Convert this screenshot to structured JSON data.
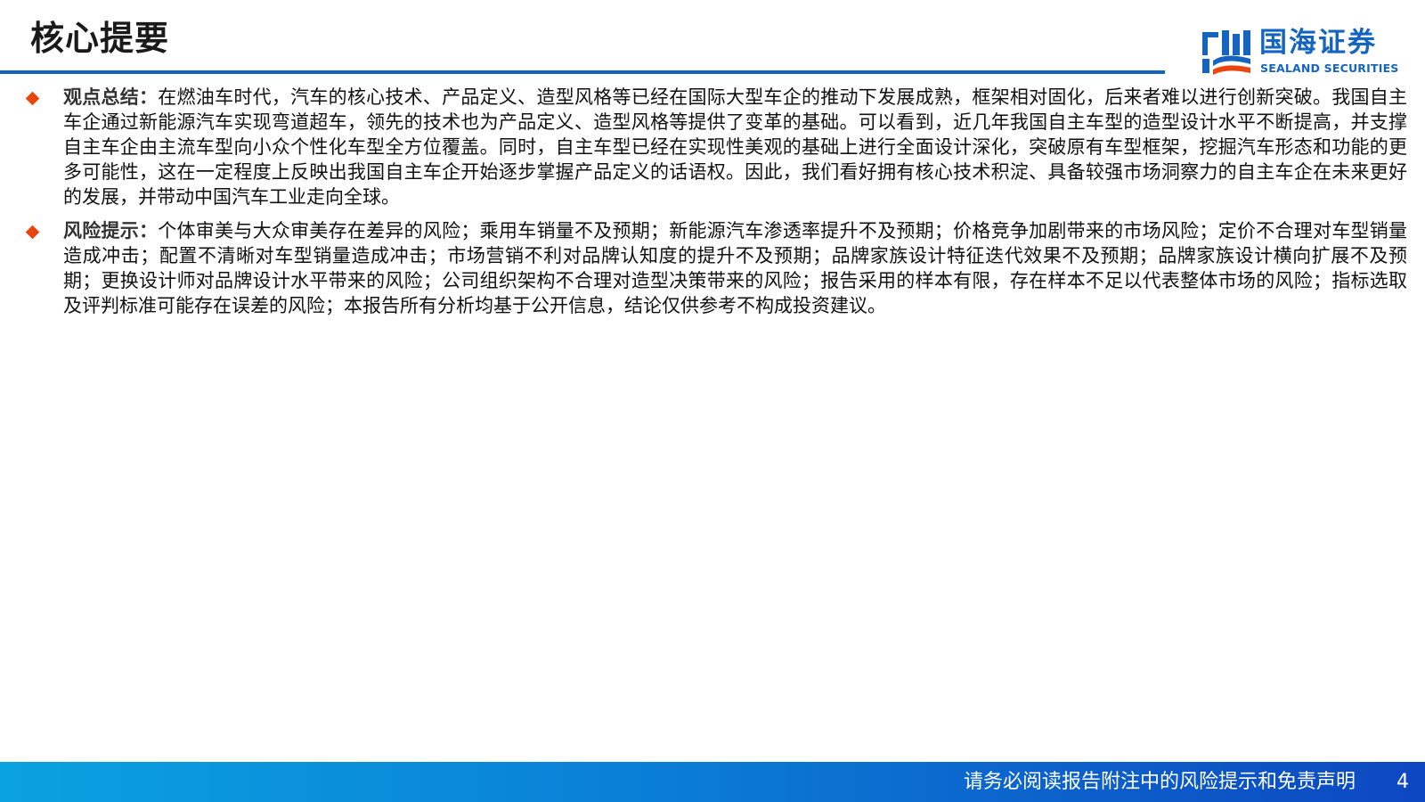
{
  "header": {
    "title": "核心提要"
  },
  "logo": {
    "name_cn": "国海证券",
    "name_en": "SEALAND SECURITIES",
    "brand_color": "#1565c0"
  },
  "bullets": [
    {
      "label": "观点总结：",
      "text": "在燃油车时代，汽车的核心技术、产品定义、造型风格等已经在国际大型车企的推动下发展成熟，框架相对固化，后来者难以进行创新突破。我国自主车企通过新能源汽车实现弯道超车，领先的技术也为产品定义、造型风格等提供了变革的基础。可以看到，近几年我国自主车型的造型设计水平不断提高，并支撑自主车企由主流车型向小众个性化车型全方位覆盖。同时，自主车型已经在实现性美观的基础上进行全面设计深化，突破原有车型框架，挖掘汽车形态和功能的更多可能性，这在一定程度上反映出我国自主车企开始逐步掌握产品定义的话语权。因此，我们看好拥有核心技术积淀、具备较强市场洞察力的自主车企在未来更好的发展，并带动中国汽车工业走向全球。"
    },
    {
      "label": "风险提示：",
      "text": "个体审美与大众审美存在差异的风险；乘用车销量不及预期；新能源汽车渗透率提升不及预期；价格竞争加剧带来的市场风险；定价不合理对车型销量造成冲击；配置不清晰对车型销量造成冲击；市场营销不利对品牌认知度的提升不及预期；品牌家族设计特征迭代效果不及预期；品牌家族设计横向扩展不及预期；更换设计师对品牌设计水平带来的风险；公司组织架构不合理对造型决策带来的风险；报告采用的样本有限，存在样本不足以代表整体市场的风险；指标选取及评判标准可能存在误差的风险；本报告所有分析均基于公开信息，结论仅供参考不构成投资建议。"
    }
  ],
  "footer": {
    "disclaimer": "请务必阅读报告附注中的风险提示和免责声明",
    "page_number": "4"
  },
  "colors": {
    "accent": "#1565c0",
    "bullet_marker": "#e8460e",
    "footer_gradient_start": "#0aa2e0",
    "footer_gradient_end": "#0d47c1"
  },
  "icons": {
    "logo_mark": "sealand-logo-icon",
    "bullet_marker": "diamond-bullet-icon"
  }
}
